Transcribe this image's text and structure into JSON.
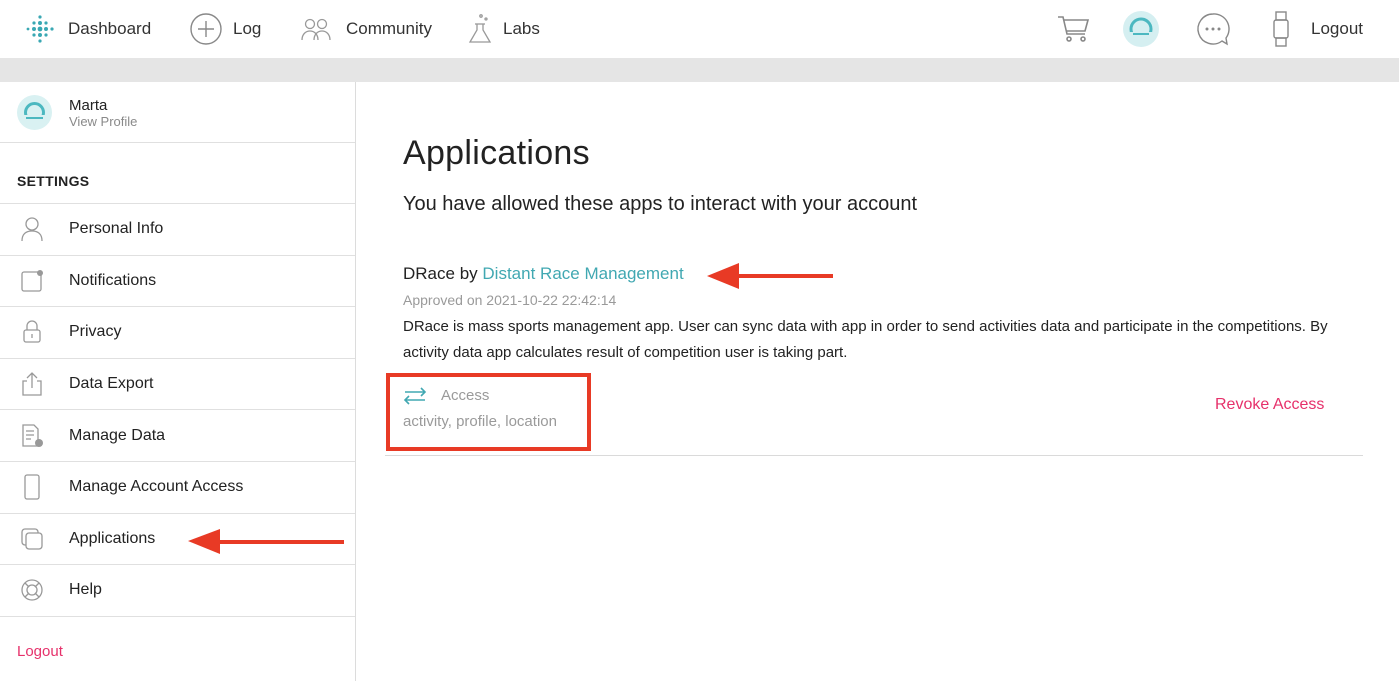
{
  "nav": {
    "dashboard": "Dashboard",
    "log": "Log",
    "community": "Community",
    "labs": "Labs",
    "logout": "Logout",
    "icons": [
      "dots-logo-icon",
      "plus-circle-icon",
      "community-icon",
      "flask-icon",
      "cart-icon",
      "avatar-icon",
      "chat-icon",
      "watch-icon"
    ]
  },
  "sidebar": {
    "profile_name": "Marta",
    "profile_link": "View Profile",
    "section_heading": "SETTINGS",
    "items": [
      {
        "label": "Personal Info",
        "icon": "person-icon"
      },
      {
        "label": "Notifications",
        "icon": "notification-icon"
      },
      {
        "label": "Privacy",
        "icon": "lock-icon"
      },
      {
        "label": "Data Export",
        "icon": "export-icon"
      },
      {
        "label": "Manage Data",
        "icon": "manage-data-icon"
      },
      {
        "label": "Manage Account Access",
        "icon": "phone-icon"
      },
      {
        "label": "Applications",
        "icon": "applications-icon"
      },
      {
        "label": "Help",
        "icon": "lifebuoy-icon"
      }
    ],
    "logout": "Logout"
  },
  "main": {
    "title": "Applications",
    "subtitle": "You have allowed these apps to interact with your account",
    "app": {
      "name": "DRace",
      "by": "by",
      "developer": "Distant Race Management",
      "approved": "Approved on 2021-10-22 22:42:14",
      "description": "DRace is mass sports management app. User can sync data with app in order to send activities data and participate in the competitions. By activity data app calculates result of competition user is taking part.",
      "access_label": "Access",
      "access_scopes": "activity, profile, location",
      "revoke": "Revoke Access"
    }
  },
  "colors": {
    "accent_teal": "#41a8b2",
    "link_pink": "#e6316b",
    "annotation_red": "#e83a25",
    "gray_bar": "#e5e5e5"
  }
}
